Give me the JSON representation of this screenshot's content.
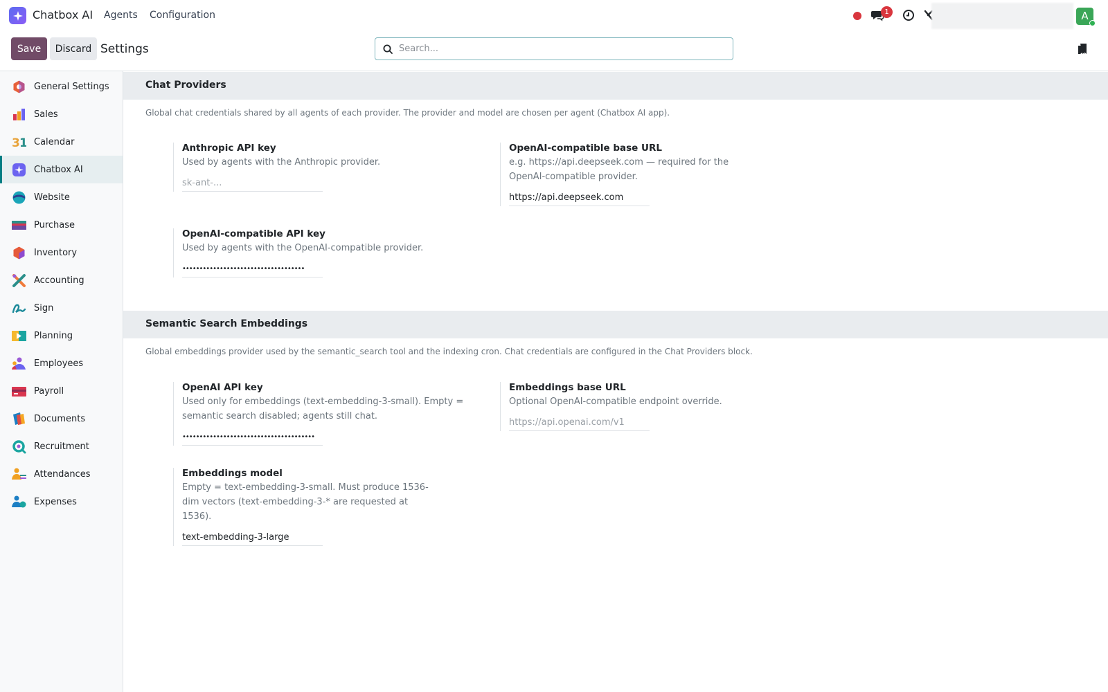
{
  "navbar": {
    "app_name": "Chatbox AI",
    "menu": [
      "Agents",
      "Configuration"
    ],
    "message_badge": "1",
    "avatar_initial": "A"
  },
  "control": {
    "save_label": "Save",
    "discard_label": "Discard",
    "title": "Settings",
    "search_placeholder": "Search..."
  },
  "sidebar": {
    "items": [
      {
        "label": "General Settings",
        "icon": "general-settings-icon",
        "color": "#e8613a"
      },
      {
        "label": "Sales",
        "icon": "sales-icon",
        "color": "#f0a021"
      },
      {
        "label": "Calendar",
        "icon": "calendar-icon",
        "color": "#e8a33a"
      },
      {
        "label": "Chatbox AI",
        "icon": "chatbox-ai-icon",
        "color": "#6b63f0",
        "active": true
      },
      {
        "label": "Website",
        "icon": "website-icon",
        "color": "#1aa5b8"
      },
      {
        "label": "Purchase",
        "icon": "purchase-icon",
        "color": "#2a8f8a"
      },
      {
        "label": "Inventory",
        "icon": "inventory-icon",
        "color": "#e65a3a"
      },
      {
        "label": "Accounting",
        "icon": "accounting-icon",
        "color": "#f07a3a"
      },
      {
        "label": "Sign",
        "icon": "sign-icon",
        "color": "#1c8a9a"
      },
      {
        "label": "Planning",
        "icon": "planning-icon",
        "color": "#f5b82e"
      },
      {
        "label": "Employees",
        "icon": "employees-icon",
        "color": "#9b5bd6"
      },
      {
        "label": "Payroll",
        "icon": "payroll-icon",
        "color": "#d9364f"
      },
      {
        "label": "Documents",
        "icon": "documents-icon",
        "color": "#f5a623"
      },
      {
        "label": "Recruitment",
        "icon": "recruitment-icon",
        "color": "#1aa5a0"
      },
      {
        "label": "Attendances",
        "icon": "attendances-icon",
        "color": "#f0a021"
      },
      {
        "label": "Expenses",
        "icon": "expenses-icon",
        "color": "#1c7fc4"
      }
    ]
  },
  "sections": {
    "chat": {
      "title": "Chat Providers",
      "description": "Global chat credentials shared by all agents of each provider. The provider and model are chosen per agent (Chatbox AI app).",
      "anthropic": {
        "label": "Anthropic API key",
        "help": "Used by agents with the Anthropic provider.",
        "placeholder": "sk-ant-...",
        "value": ""
      },
      "base_url": {
        "label": "OpenAI-compatible base URL",
        "help": "e.g. https://api.deepseek.com — required for the OpenAI-compatible provider.",
        "value": "https://api.deepseek.com"
      },
      "openai_key": {
        "label": "OpenAI-compatible API key",
        "help": "Used by agents with the OpenAI-compatible provider.",
        "value": "••••••••••••••••••••••••••••••••••••"
      }
    },
    "embeddings": {
      "title": "Semantic Search Embeddings",
      "description": "Global embeddings provider used by the semantic_search tool and the indexing cron. Chat credentials are configured in the Chat Providers block.",
      "openai_key": {
        "label": "OpenAI API key",
        "help": "Used only for embeddings (text-embedding-3-small). Empty = semantic search disabled; agents still chat.",
        "value": "•••••••••••••••••••••••••••••••••••••••"
      },
      "base_url": {
        "label": "Embeddings base URL",
        "help": "Optional OpenAI-compatible endpoint override.",
        "placeholder": "https://api.openai.com/v1",
        "value": ""
      },
      "model": {
        "label": "Embeddings model",
        "help": "Empty = text-embedding-3-small. Must produce 1536-dim vectors (text-embedding-3-* are requested at 1536).",
        "value": "text-embedding-3-large"
      }
    }
  },
  "colors": {
    "brand": "#714b67",
    "accent": "#017e84"
  }
}
